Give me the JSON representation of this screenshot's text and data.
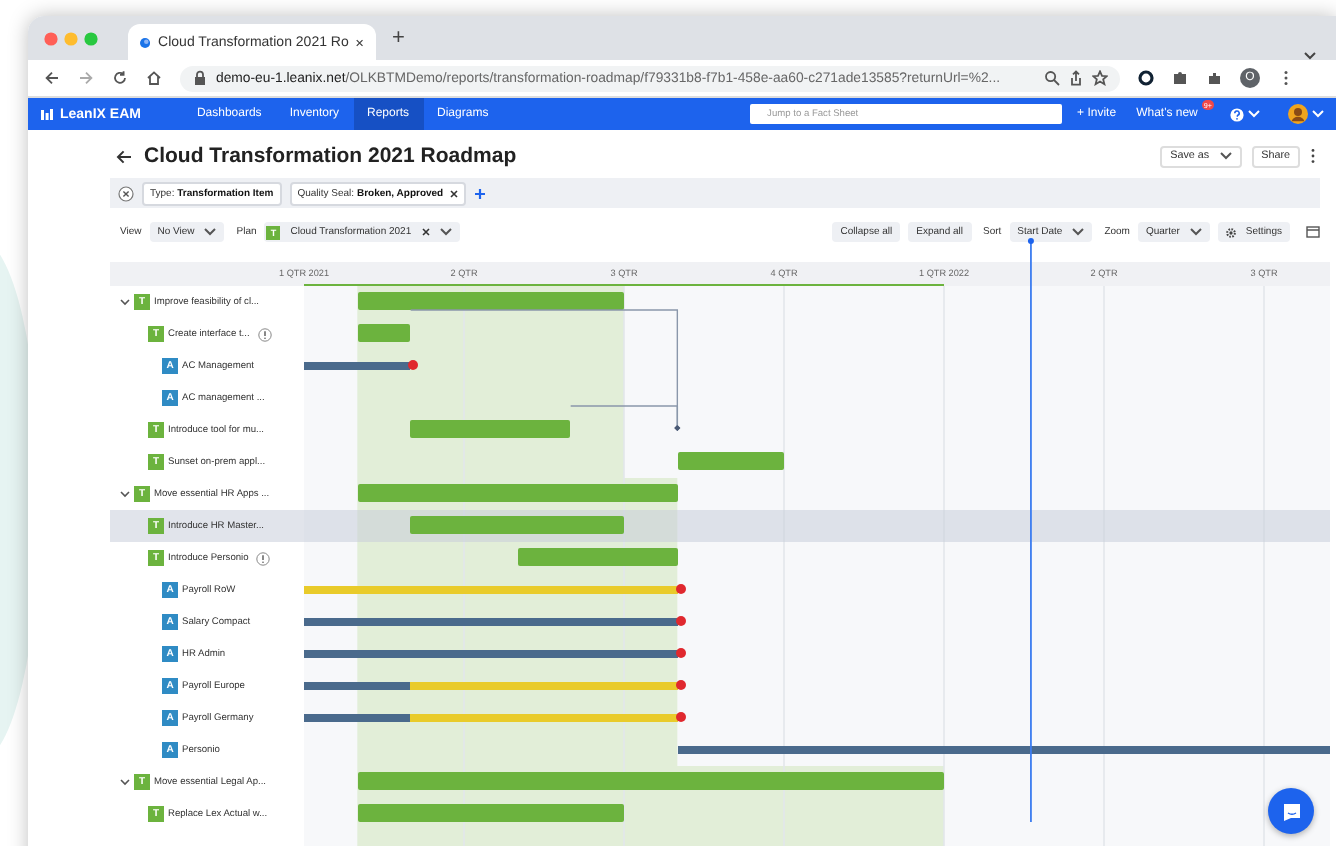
{
  "browser": {
    "tab_title": "Cloud Transformation 2021 Ro",
    "new_tab": "+",
    "url_host": "demo-eu-1.leanix.net",
    "url_path": "/OLKBTMDemo/reports/transformation-roadmap/f79331b8-f7b1-458e-aa60-c271ade13585?returnUrl=%2...",
    "profile_initial": "O"
  },
  "nav": {
    "logo": "LeanIX EAM",
    "items": [
      {
        "label": "Dashboards",
        "selected": false
      },
      {
        "label": "Inventory",
        "selected": false
      },
      {
        "label": "Reports",
        "selected": true
      },
      {
        "label": "Diagrams",
        "selected": false
      }
    ],
    "search": {
      "placeholder": "Jump to a Fact Sheet"
    },
    "invite": "+ Invite",
    "whats_new": "What's new",
    "badge": "9+"
  },
  "report": {
    "title": "Cloud Transformation 2021 Roadmap",
    "save_as": "Save as",
    "share": "Share"
  },
  "filters": {
    "chips": [
      {
        "text": "Type: **Transformation Item**",
        "removable": false
      },
      {
        "text": "Quality Seal: **Broken, Approved**",
        "removable": true
      }
    ]
  },
  "toolbar": {
    "view_label": "View",
    "view": "No View",
    "plan_label": "Plan",
    "plan_badge": "T",
    "plan": "Cloud Transformation 2021",
    "collapse": "Collapse all",
    "expand": "Expand all",
    "sort_label": "Sort",
    "sort": "Start Date",
    "zoom_label": "Zoom",
    "zoom": "Quarter",
    "settings": "Settings"
  },
  "gantt": {
    "quarters": [
      "1 QTR 2021",
      "2 QTR",
      "3 QTR",
      "4 QTR",
      "1 QTR 2022",
      "2 QTR",
      "3 QTR"
    ],
    "rows": [
      {
        "kind": "initiative",
        "badge": "T",
        "name": "Improve feasibility of cl...",
        "expanded": true,
        "selected": false,
        "flagged": false,
        "children": [
          {
            "kind": "initiative",
            "badge": "T",
            "name": "Create interface t...",
            "selected": false,
            "flagged": true,
            "children": [
              {
                "kind": "application",
                "badge": "A",
                "name": "AC Management",
                "selected": false,
                "flagged": false,
                "end_of_life": true,
                "segments": [
                  {
                    "kind": "active"
                  }
                ]
              },
              {
                "kind": "application",
                "badge": "A",
                "name": "AC management ...",
                "selected": false,
                "flagged": false,
                "end_of_life": false
              }
            ]
          },
          {
            "kind": "initiative",
            "badge": "T",
            "name": "Introduce tool for mu...",
            "selected": false,
            "flagged": false
          },
          {
            "kind": "initiative",
            "badge": "T",
            "name": "Sunset on-prem appl...",
            "selected": false,
            "flagged": false
          }
        ]
      },
      {
        "kind": "initiative",
        "badge": "T",
        "name": "Move essential HR Apps ...",
        "expanded": true,
        "selected": false,
        "flagged": false,
        "children": [
          {
            "kind": "initiative",
            "badge": "T",
            "name": "Introduce HR Master...",
            "selected": true,
            "flagged": false
          },
          {
            "kind": "initiative",
            "badge": "T",
            "name": "Introduce Personio",
            "selected": false,
            "flagged": true,
            "children": [
              {
                "kind": "application",
                "badge": "A",
                "name": "Payroll RoW",
                "selected": false,
                "flagged": false,
                "end_of_life": true,
                "segments": [
                  {
                    "kind": "phase-in"
                  }
                ]
              },
              {
                "kind": "application",
                "badge": "A",
                "name": "Salary Compact",
                "selected": false,
                "flagged": false,
                "end_of_life": true,
                "segments": [
                  {
                    "kind": "active"
                  }
                ]
              },
              {
                "kind": "application",
                "badge": "A",
                "name": "HR Admin",
                "selected": false,
                "flagged": false,
                "end_of_life": true,
                "segments": [
                  {
                    "kind": "active"
                  }
                ]
              },
              {
                "kind": "application",
                "badge": "A",
                "name": "Payroll Europe",
                "selected": false,
                "flagged": false,
                "end_of_life": true,
                "segments": [
                  {
                    "kind": "active"
                  },
                  {
                    "kind": "phase-in"
                  }
                ]
              },
              {
                "kind": "application",
                "badge": "A",
                "name": "Payroll Germany",
                "selected": false,
                "flagged": false,
                "end_of_life": true,
                "segments": [
                  {
                    "kind": "active"
                  },
                  {
                    "kind": "phase-in"
                  }
                ]
              },
              {
                "kind": "application",
                "badge": "A",
                "name": "Personio",
                "selected": false,
                "flagged": false,
                "end_of_life": false,
                "segments": [
                  {
                    "kind": "active"
                  }
                ]
              }
            ]
          }
        ]
      },
      {
        "kind": "initiative",
        "badge": "T",
        "name": "Move essential Legal Ap...",
        "expanded": true,
        "selected": false,
        "flagged": false,
        "children": [
          {
            "kind": "initiative",
            "badge": "T",
            "name": "Replace Lex Actual w...",
            "selected": false,
            "flagged": false
          }
        ]
      }
    ]
  }
}
